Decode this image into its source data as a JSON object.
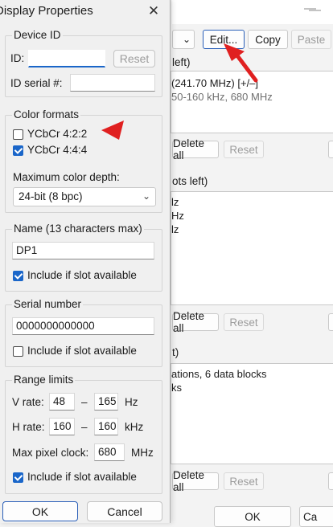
{
  "dialog": {
    "title": "Display Properties",
    "device_id": {
      "group_label": "Device ID",
      "id_label": "ID:",
      "id_value": "",
      "reset_label": "Reset",
      "serial_label": "ID serial #:",
      "serial_value": ""
    },
    "color_formats": {
      "group_label": "Color formats",
      "options": [
        {
          "label": "YCbCr 4:2:2",
          "checked": false
        },
        {
          "label": "YCbCr 4:4:4",
          "checked": true
        }
      ],
      "depth_label": "Maximum color depth:",
      "depth_value": "24-bit (8 bpc)"
    },
    "name": {
      "group_label": "Name (13 characters max)",
      "value": "DP1",
      "include_label": "Include if slot available",
      "include_checked": true
    },
    "serial": {
      "group_label": "Serial number",
      "value": "0000000000000",
      "include_label": "Include if slot available",
      "include_checked": false
    },
    "range": {
      "group_label": "Range limits",
      "v_label": "V rate:",
      "v_min": "48",
      "v_max": "165",
      "v_unit": "Hz",
      "h_label": "H rate:",
      "h_min": "160",
      "h_max": "160",
      "h_unit": "kHz",
      "dash": "–",
      "clock_label": "Max pixel clock:",
      "clock_value": "680",
      "clock_unit": "MHz",
      "include_label": "Include if slot available",
      "include_checked": true
    },
    "ok_label": "OK",
    "cancel_label": "Cancel"
  },
  "background": {
    "edit_label": "Edit...",
    "copy_label": "Copy",
    "paste_label": "Paste",
    "section1_header": "left)",
    "section1_line1": "(241.70 MHz) [+/–]",
    "section1_line2": "50-160 kHz, 680 MHz",
    "delete_all_label": "Delete all",
    "reset_label": "Reset",
    "section2_header": "ots left)",
    "section2_lines": [
      "lz",
      "Hz",
      "lz"
    ],
    "section3_header": "t)",
    "section3_line1": "ations, 6 data blocks",
    "section3_line2": "ks",
    "ok_label": "OK",
    "ca_label": "Ca"
  },
  "annotation_color": "#e02020"
}
